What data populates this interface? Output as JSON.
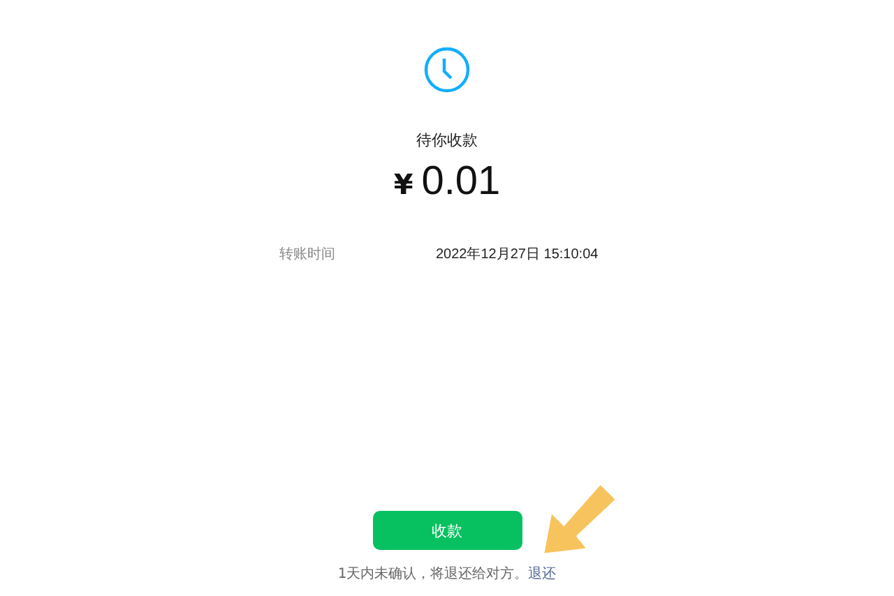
{
  "status": {
    "title": "待你收款",
    "amount": "0.01",
    "currency": "¥"
  },
  "details": [
    {
      "label": "转账时间",
      "value": "2022年12月27日 15:10:04"
    }
  ],
  "button": "收款",
  "notice": {
    "text": "1天内未确认，将退还给对方。",
    "link": "退还"
  }
}
